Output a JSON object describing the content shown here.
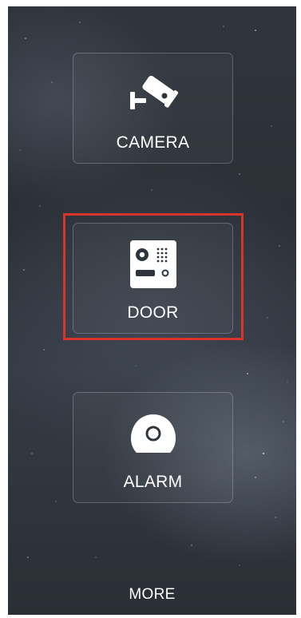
{
  "menu": {
    "items": [
      {
        "label": "CAMERA",
        "icon": "cctv-camera-icon"
      },
      {
        "label": "DOOR",
        "icon": "door-intercom-icon",
        "highlighted": true
      },
      {
        "label": "ALARM",
        "icon": "alarm-sensor-icon"
      }
    ],
    "more_label": "MORE"
  },
  "colors": {
    "highlight_border": "#d9342b",
    "text": "#ffffff",
    "tile_border": "#bec8d4"
  }
}
